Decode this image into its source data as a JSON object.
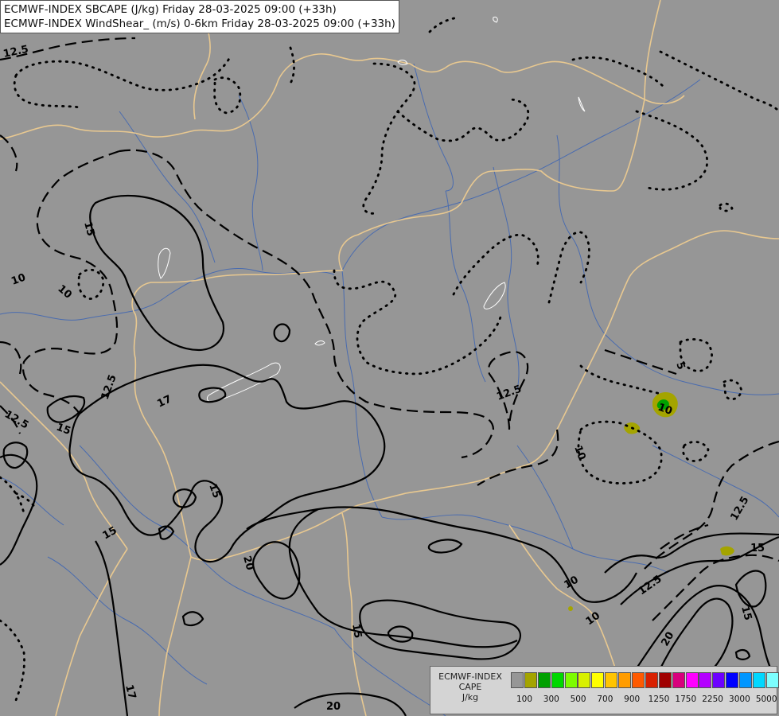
{
  "title": {
    "line1": "ECMWF-INDEX SBCAPE (J/kg) Friday 28-03-2025 09:00 (+33h)",
    "line2": "ECMWF-INDEX WindShear_ (m/s) 0-6km Friday 28-03-2025 09:00 (+33h)"
  },
  "contour_labels": [
    "12.5",
    "15",
    "10",
    "10",
    "12.5",
    "17",
    "15",
    "12.5",
    "15",
    "15",
    "20",
    "15",
    "17",
    "20",
    "12.5",
    "10",
    "5",
    "10",
    "10",
    "12.5",
    "15",
    "15",
    "12.5",
    "10",
    "20"
  ],
  "legend": {
    "name_line1": "ECMWF-INDEX",
    "name_line2": "CAPE",
    "name_line3": "J/kg",
    "colors": [
      "#969696",
      "#a4a400",
      "#00a000",
      "#00d800",
      "#7cfc00",
      "#d8f000",
      "#ffff00",
      "#ffc400",
      "#ff9c00",
      "#ff5a00",
      "#d82000",
      "#a00000",
      "#d8007c",
      "#ff00ff",
      "#b400ff",
      "#6c00ff",
      "#0000ff",
      "#0096ff",
      "#00d8ff",
      "#7cffff",
      "#ffffff"
    ],
    "tick_labels": [
      "100",
      "300",
      "500",
      "700",
      "900",
      "1250",
      "1750",
      "2250",
      "3000",
      "5000"
    ]
  },
  "colors": {
    "background": "#969696",
    "borders": "#e8c890",
    "rivers": "#3c64b4",
    "contours": "#000000",
    "cape_low": "#a4a400",
    "cape_mid": "#00a000"
  }
}
